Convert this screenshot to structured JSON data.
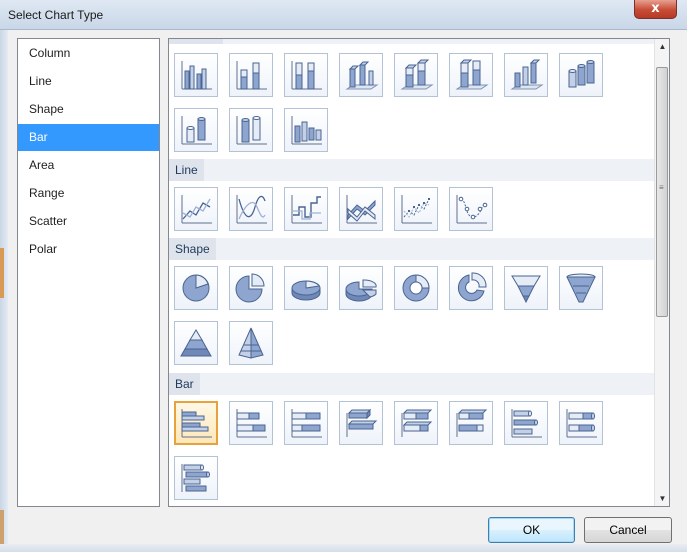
{
  "window": {
    "title": "Select Chart Type",
    "close_glyph": "x"
  },
  "chart_types": [
    {
      "label": "Column",
      "selected": false
    },
    {
      "label": "Line",
      "selected": false
    },
    {
      "label": "Shape",
      "selected": false
    },
    {
      "label": "Bar",
      "selected": true
    },
    {
      "label": "Area",
      "selected": false
    },
    {
      "label": "Range",
      "selected": false
    },
    {
      "label": "Scatter",
      "selected": false
    },
    {
      "label": "Polar",
      "selected": false
    }
  ],
  "sections": {
    "line": {
      "label": "Line"
    },
    "shape": {
      "label": "Shape"
    },
    "bar": {
      "label": "Bar"
    }
  },
  "gallery_icons": {
    "column": [
      "clustered-column-icon",
      "stacked-column-icon",
      "100-stacked-column-icon",
      "3d-clustered-column-icon",
      "3d-stacked-column-icon",
      "3d-100-stacked-column-icon",
      "3d-column-icon",
      "cylinder-column-icon",
      "stacked-cylinder-column-icon",
      "100-stacked-cylinder-column-icon",
      "3d-cylinder-column-icon"
    ],
    "line": [
      "line-icon",
      "smooth-line-icon",
      "stepped-line-icon",
      "3d-line-icon",
      "line-with-markers-icon",
      "smooth-line-with-markers-icon"
    ],
    "shape": [
      "pie-icon",
      "exploded-pie-icon",
      "3d-pie-icon",
      "3d-exploded-pie-icon",
      "doughnut-icon",
      "exploded-doughnut-icon",
      "funnel-icon",
      "3d-funnel-icon",
      "pyramid-icon",
      "3d-pyramid-icon"
    ],
    "bar": [
      "clustered-bar-icon",
      "stacked-bar-icon",
      "100-stacked-bar-icon",
      "3d-clustered-bar-icon",
      "3d-stacked-bar-icon",
      "3d-100-stacked-bar-icon",
      "cylinder-bar-icon",
      "stacked-cylinder-bar-icon",
      "3d-cylinder-bar-icon"
    ]
  },
  "selected_chart_icon": "clustered-bar-icon",
  "buttons": {
    "ok": "OK",
    "cancel": "Cancel"
  },
  "scroll": {
    "up_glyph": "▲",
    "down_glyph": "▼",
    "grip_glyph": "≡"
  },
  "colors": {
    "selection": "#3399ff",
    "tile_selected_border": "#e6a23c",
    "section_text": "#1e395b"
  }
}
